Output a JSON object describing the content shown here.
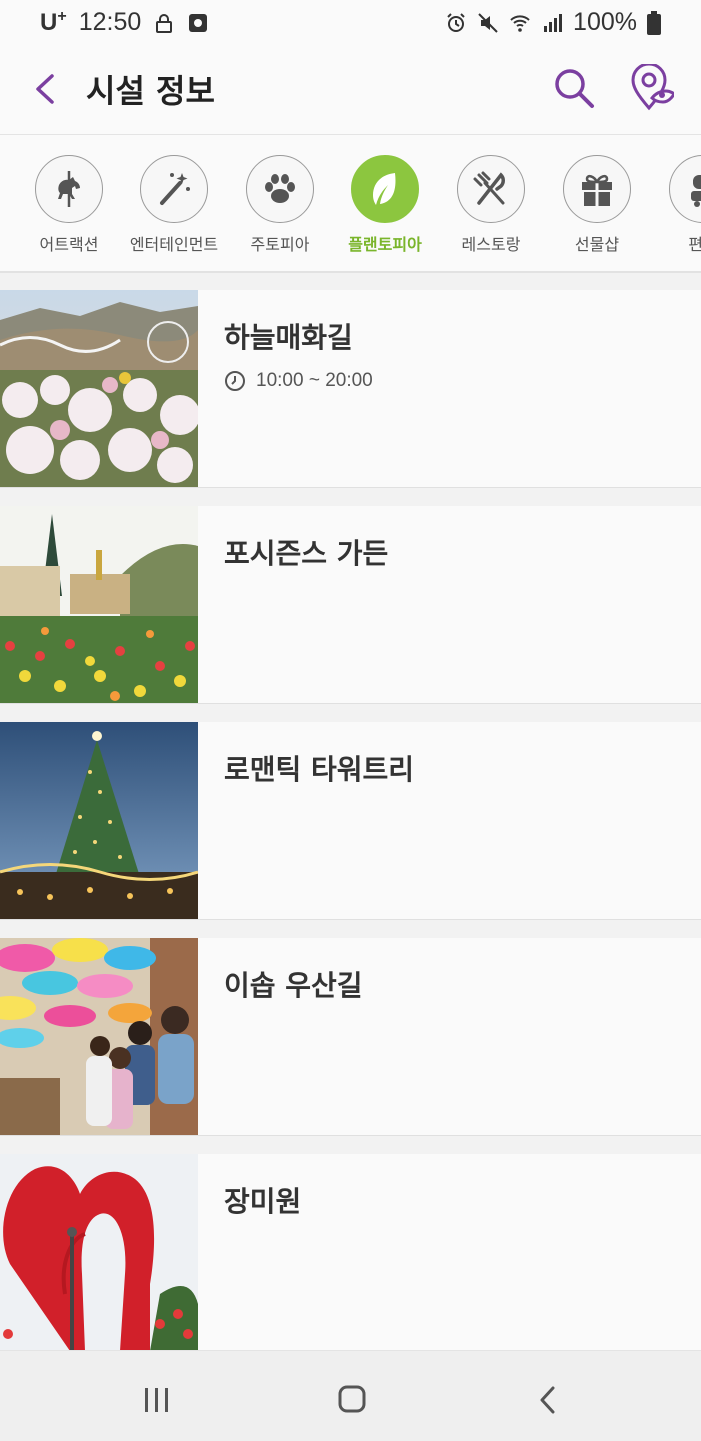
{
  "status_bar": {
    "carrier": "U",
    "carrier_sup": "+",
    "time": "12:50",
    "battery": "100%"
  },
  "header": {
    "title": "시설 정보"
  },
  "categories": [
    {
      "label": "어트랙션",
      "icon": "carousel-horse-icon",
      "active": false
    },
    {
      "label": "엔터테인먼트",
      "icon": "magic-wand-icon",
      "active": false
    },
    {
      "label": "주토피아",
      "icon": "paw-icon",
      "active": false
    },
    {
      "label": "플랜토피아",
      "icon": "leaf-icon",
      "active": true
    },
    {
      "label": "레스토랑",
      "icon": "fork-knife-icon",
      "active": false
    },
    {
      "label": "선물샵",
      "icon": "gift-icon",
      "active": false
    },
    {
      "label": "편의",
      "icon": "convenience-icon",
      "active": false
    }
  ],
  "facilities": [
    {
      "title": "하늘매화길",
      "hours": "10:00 ~ 20:00"
    },
    {
      "title": "포시즌스 가든",
      "hours": ""
    },
    {
      "title": "로맨틱 타워트리",
      "hours": ""
    },
    {
      "title": "이솝 우산길",
      "hours": ""
    },
    {
      "title": "장미원",
      "hours": ""
    }
  ],
  "colors": {
    "accent_purple": "#7b3fa0",
    "active_green": "#8cc63f"
  }
}
